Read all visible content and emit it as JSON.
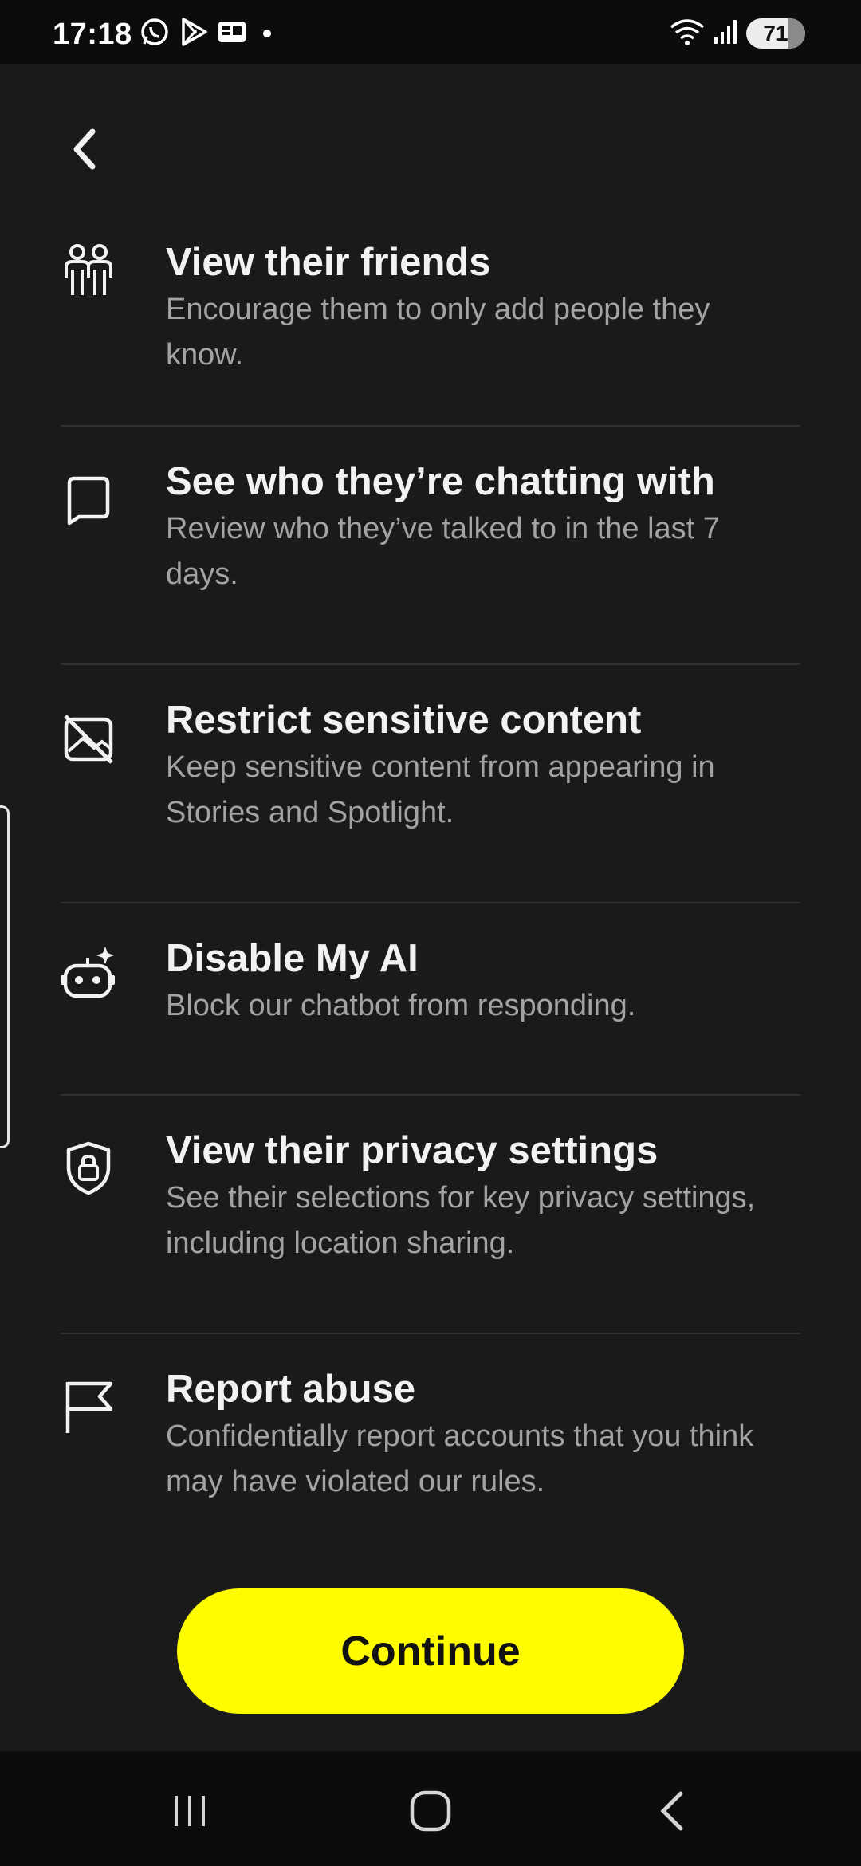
{
  "status_bar": {
    "time": "17:18",
    "battery": "71",
    "left_icons": [
      "whatsapp-icon",
      "play-store-icon",
      "news-icon",
      "dot-icon"
    ],
    "right_icons": [
      "wifi-icon",
      "signal-icon",
      "battery-icon"
    ]
  },
  "features": [
    {
      "icon": "friends-icon",
      "title": "View their friends",
      "description": "Encourage them to only add people they know."
    },
    {
      "icon": "chat-icon",
      "title": "See who they’re chatting with",
      "description": "Review who they’ve talked to in the last 7 days."
    },
    {
      "icon": "restricted-content-icon",
      "title": "Restrict sensitive content",
      "description": "Keep sensitive content from appearing in Stories and Spotlight."
    },
    {
      "icon": "robot-icon",
      "title": "Disable My AI",
      "description": "Block our chatbot from responding."
    },
    {
      "icon": "shield-lock-icon",
      "title": "View their privacy settings",
      "description": "See their selections for key privacy settings, including location sharing."
    },
    {
      "icon": "flag-icon",
      "title": "Report abuse",
      "description": "Confidentially report accounts that you think may have violated our rules."
    }
  ],
  "continue_label": "Continue",
  "colors": {
    "background": "#1a1a1a",
    "accent": "#fffc00",
    "divider": "#303030"
  },
  "nav_bar": {
    "buttons": [
      "recents-icon",
      "home-icon",
      "back-icon"
    ]
  }
}
